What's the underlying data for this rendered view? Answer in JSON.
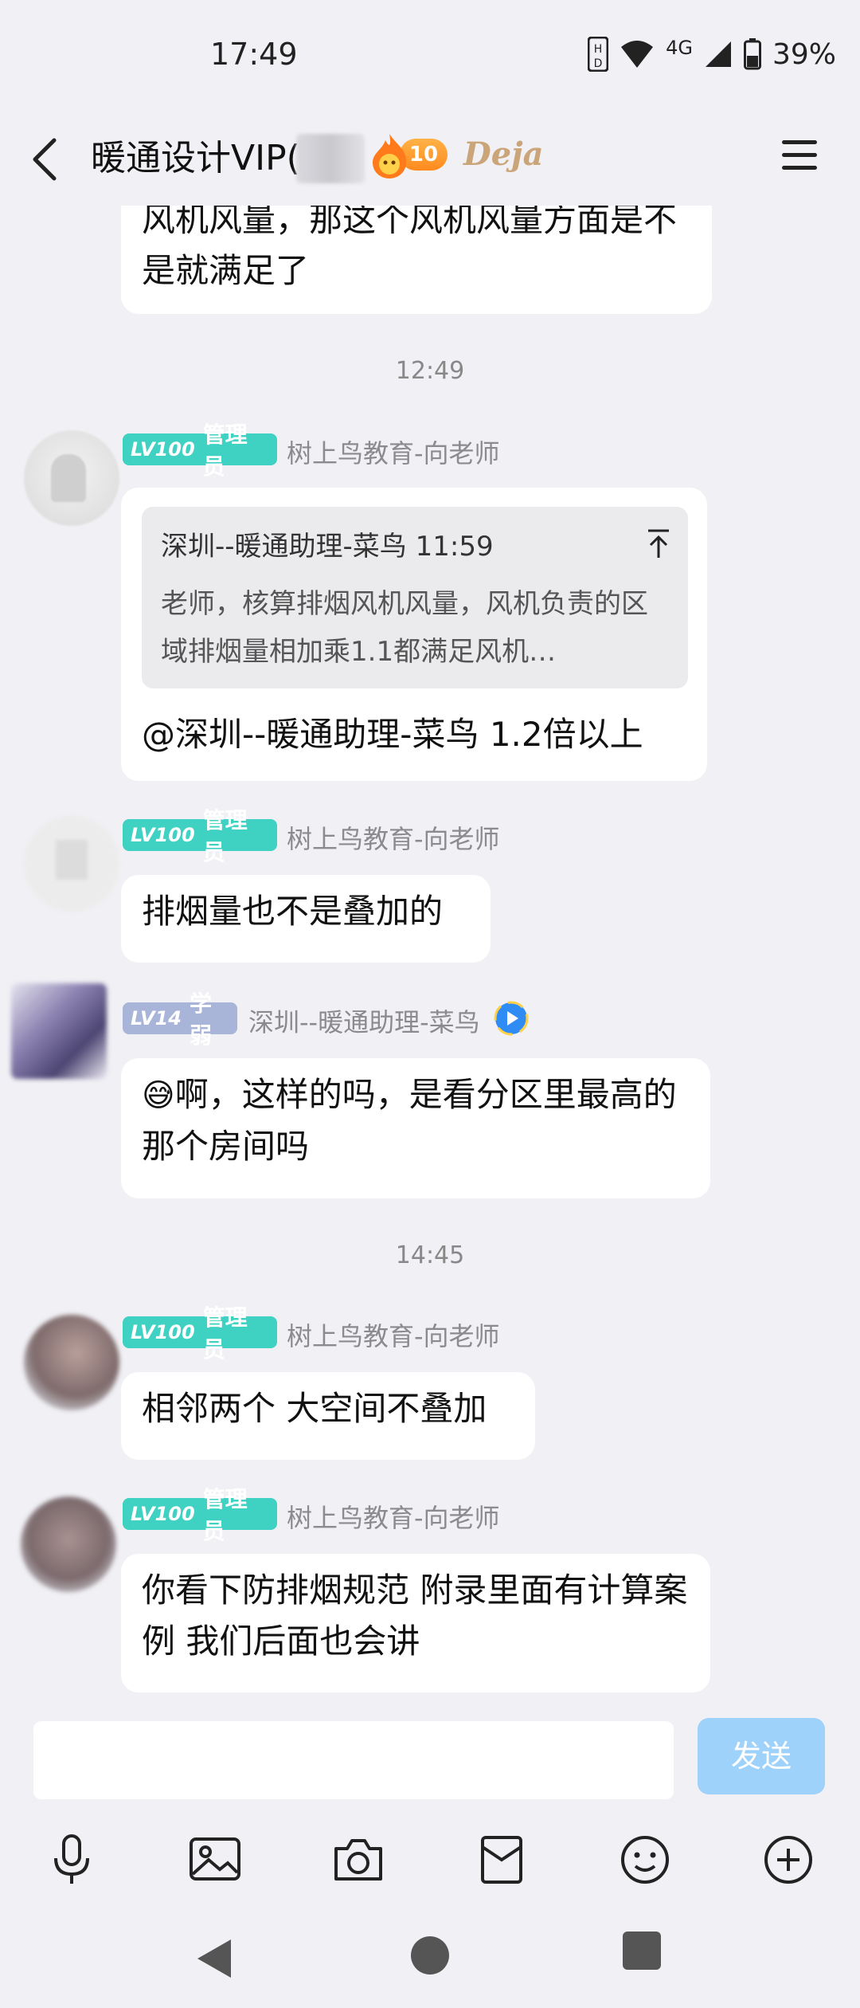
{
  "status_bar": {
    "time": "17:49",
    "network": "4G",
    "battery": "39%"
  },
  "header": {
    "title": "暖通设计VIP(",
    "level": "10",
    "brand": "Deja"
  },
  "messages": [
    {
      "text": "风机风量，那这个风机风量方面是不是就满足了"
    },
    {
      "time": "12:49"
    },
    {
      "level": "LV100",
      "role": "管理员",
      "sender": "树上鸟教育-向老师",
      "quote_meta": "深圳--暖通助理-菜鸟 11:59",
      "quote_text": "老师，核算排烟风机风量，风机负责的区域排烟量相加乘1.1都满足风机…",
      "text": "@深圳--暖通助理-菜鸟 1.2倍以上"
    },
    {
      "level": "LV100",
      "role": "管理员",
      "sender": "树上鸟教育-向老师",
      "text": "排烟量也不是叠加的"
    },
    {
      "level": "LV14",
      "role": "学弱",
      "sender": "深圳--暖通助理-菜鸟",
      "emoji": "😅",
      "text": "啊，这样的吗，是看分区里最高的那个房间吗"
    },
    {
      "time": "14:45"
    },
    {
      "level": "LV100",
      "role": "管理员",
      "sender": "树上鸟教育-向老师",
      "text": "相邻两个 大空间不叠加"
    },
    {
      "level": "LV100",
      "role": "管理员",
      "sender": "树上鸟教育-向老师",
      "text": "你看下防排烟规范 附录里面有计算案例 我们后面也会讲"
    }
  ],
  "input": {
    "placeholder": "",
    "send_label": "发送"
  },
  "toolbar": [
    "microphone-icon",
    "image-icon",
    "camera-icon",
    "red-packet-icon",
    "emoji-icon",
    "plus-icon"
  ],
  "colors": {
    "admin_badge": "#3fd1c2",
    "member_badge": "#a8b4d8",
    "send_button": "#9fd2fb",
    "background": "#f1f1f5"
  }
}
